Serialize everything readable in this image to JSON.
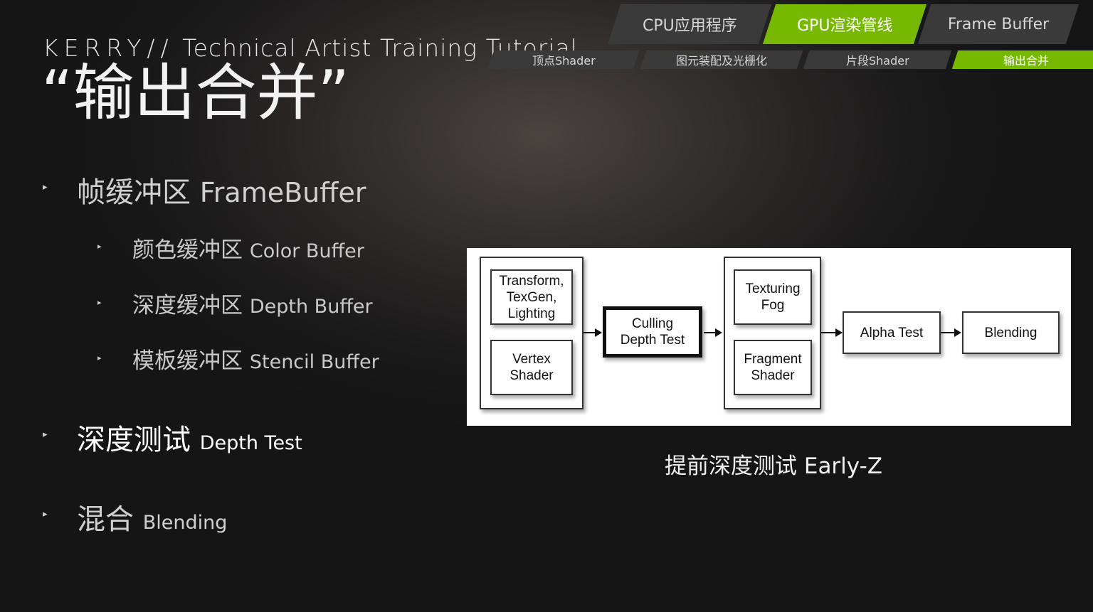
{
  "header": {
    "brand_prefix": "KERRY//",
    "brand_rest": " Technical Artist Training Tutorial",
    "title": "“输出合并”"
  },
  "nav": {
    "top_tabs": [
      {
        "label": "CPU应用程序",
        "active": false
      },
      {
        "label": "GPU渲染管线",
        "active": true
      },
      {
        "label": "Frame Buffer",
        "active": false
      }
    ],
    "sub_tabs": [
      {
        "label": "顶点Shader",
        "active": false
      },
      {
        "label": "图元装配及光栅化",
        "active": false
      },
      {
        "label": "片段Shader",
        "active": false
      },
      {
        "label": "输出合并",
        "active": true
      }
    ],
    "accent_color": "#76b900"
  },
  "list": {
    "bullet_glyph": "▸",
    "framebuffer": {
      "zh": "帧缓冲区 ",
      "en": "FrameBuffer"
    },
    "color_buffer": {
      "zh": "颜色缓冲区 ",
      "en": "Color Buffer"
    },
    "depth_buffer": {
      "zh": "深度缓冲区 ",
      "en": "Depth Buffer"
    },
    "stencil_buffer": {
      "zh": "模板缓冲区 ",
      "en": "Stencil Buffer"
    },
    "depth_test": {
      "zh": "深度测试 ",
      "en": "Depth Test"
    },
    "blending": {
      "zh": "混合 ",
      "en": "Blending"
    }
  },
  "diagram": {
    "transform": [
      "Transform,",
      "TexGen,",
      "Lighting"
    ],
    "vertex_shader": [
      "Vertex",
      "Shader"
    ],
    "culling": [
      "Culling",
      "Depth Test"
    ],
    "texturing": [
      "Texturing",
      "Fog"
    ],
    "fragment_shader": [
      "Fragment",
      "Shader"
    ],
    "alpha_test": "Alpha Test",
    "blending": "Blending",
    "caption": "提前深度测试 Early-Z"
  }
}
